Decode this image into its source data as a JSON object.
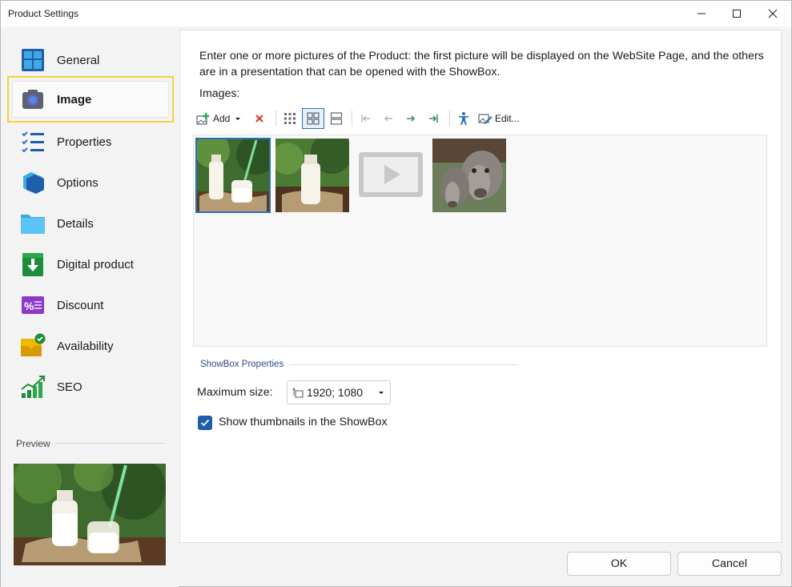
{
  "window": {
    "title": "Product Settings"
  },
  "sidebar": {
    "items": [
      {
        "label": "General",
        "icon": "general-icon"
      },
      {
        "label": "Image",
        "icon": "camera-icon",
        "selected": true
      },
      {
        "label": "Properties",
        "icon": "properties-list-icon"
      },
      {
        "label": "Options",
        "icon": "options-layers-icon"
      },
      {
        "label": "Details",
        "icon": "details-folder-icon"
      },
      {
        "label": "Digital product",
        "icon": "download-icon"
      },
      {
        "label": "Discount",
        "icon": "discount-icon"
      },
      {
        "label": "Availability",
        "icon": "availability-box-icon"
      },
      {
        "label": "SEO",
        "icon": "seo-chart-icon"
      }
    ],
    "preview_label": "Preview"
  },
  "content": {
    "description": "Enter one or more pictures of the Product: the first picture will be displayed on the WebSite Page, and the others are in a presentation that can be opened with the ShowBox.",
    "images_label": "Images:",
    "toolbar": {
      "add_label": "Add",
      "edit_label": "Edit..."
    },
    "gallery": {
      "items": [
        {
          "kind": "image",
          "subject": "milk bottle and jar with green straw",
          "selected": true
        },
        {
          "kind": "image",
          "subject": "milk bottle on burlap"
        },
        {
          "kind": "video",
          "subject": "video placeholder"
        },
        {
          "kind": "image",
          "subject": "cows"
        }
      ]
    },
    "showbox": {
      "header": "ShowBox Properties",
      "max_size_label": "Maximum size:",
      "max_size_value": "1920; 1080",
      "show_thumbnails_label": "Show thumbnails in the ShowBox",
      "show_thumbnails_checked": true
    }
  },
  "buttons": {
    "ok": "OK",
    "cancel": "Cancel"
  },
  "colors": {
    "selection_highlight": "#f2d33b",
    "accent": "#1f5ea8",
    "showbox_header": "#2b4b8a"
  }
}
